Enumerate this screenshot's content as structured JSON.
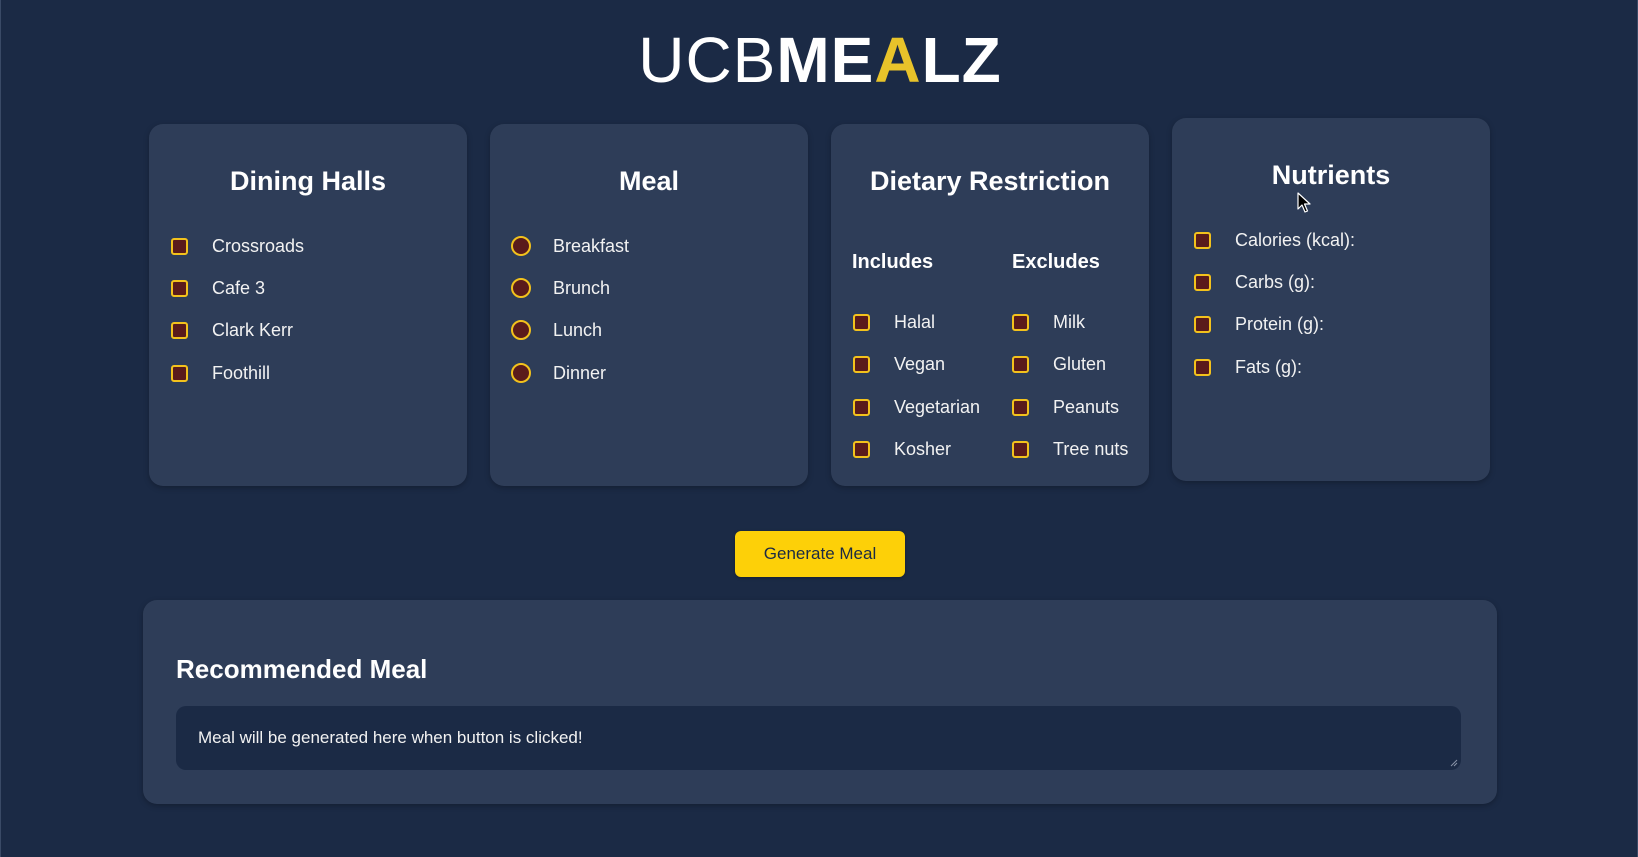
{
  "logo": {
    "part_thin": "UCB",
    "part_bold1": "ME",
    "part_gold": "A",
    "part_bold2": "LZ"
  },
  "dining": {
    "title": "Dining Halls",
    "items": [
      "Crossroads",
      "Cafe 3",
      "Clark Kerr",
      "Foothill"
    ]
  },
  "meal": {
    "title": "Meal",
    "items": [
      "Breakfast",
      "Brunch",
      "Lunch",
      "Dinner"
    ]
  },
  "dietary": {
    "title": "Dietary Restriction",
    "includes_label": "Includes",
    "excludes_label": "Excludes",
    "includes": [
      "Halal",
      "Vegan",
      "Vegetarian",
      "Kosher"
    ],
    "excludes": [
      "Milk",
      "Gluten",
      "Peanuts",
      "Tree nuts"
    ]
  },
  "nutrients": {
    "title": "Nutrients",
    "items": [
      "Calories (kcal):",
      "Carbs (g):",
      "Protein (g):",
      "Fats (g):"
    ]
  },
  "generate": {
    "label": "Generate Meal"
  },
  "result": {
    "title": "Recommended Meal",
    "placeholder": "Meal will be generated here when button is clicked!"
  },
  "colors": {
    "background": "#1b2a45",
    "card": "#2e3d58",
    "accent": "#fdd008",
    "checkbox_fill": "#5a1b1b"
  }
}
